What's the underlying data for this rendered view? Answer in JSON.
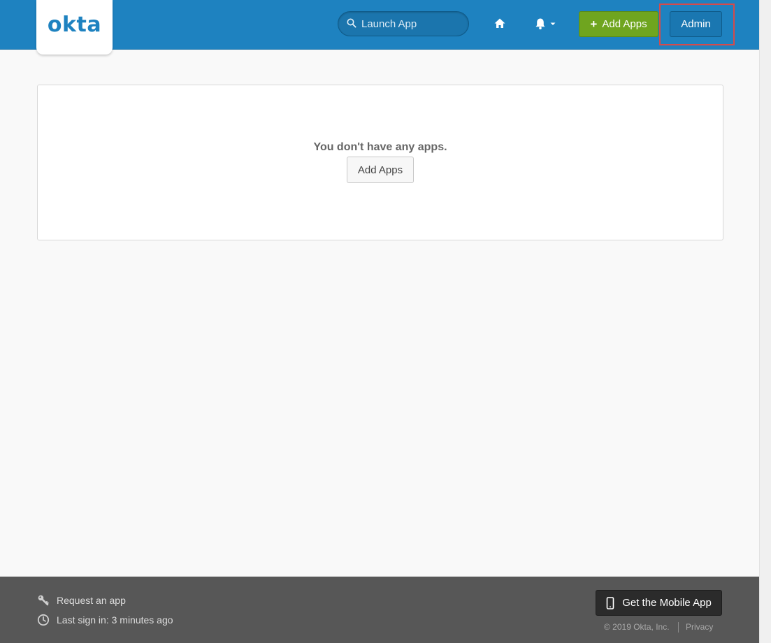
{
  "header": {
    "logo_text": "okta",
    "search": {
      "placeholder": "Launch App",
      "value": ""
    },
    "home_icon": "home-icon",
    "notifications_icon": "bell-icon",
    "add_apps_label": "Add Apps",
    "admin_label": "Admin"
  },
  "main": {
    "empty_message": "You don't have any apps.",
    "add_apps_label": "Add Apps"
  },
  "footer": {
    "request_app_label": "Request an app",
    "last_sign_in": "Last sign in: 3 minutes ago",
    "mobile_app_label": "Get the Mobile App",
    "copyright": "© 2019 Okta, Inc.",
    "privacy_label": "Privacy"
  },
  "colors": {
    "header_bg": "#1e82c0",
    "brand": "#1e82c0",
    "add_button": "#6fa51f",
    "highlight": "#d64a4a",
    "footer_bg": "#575757"
  }
}
